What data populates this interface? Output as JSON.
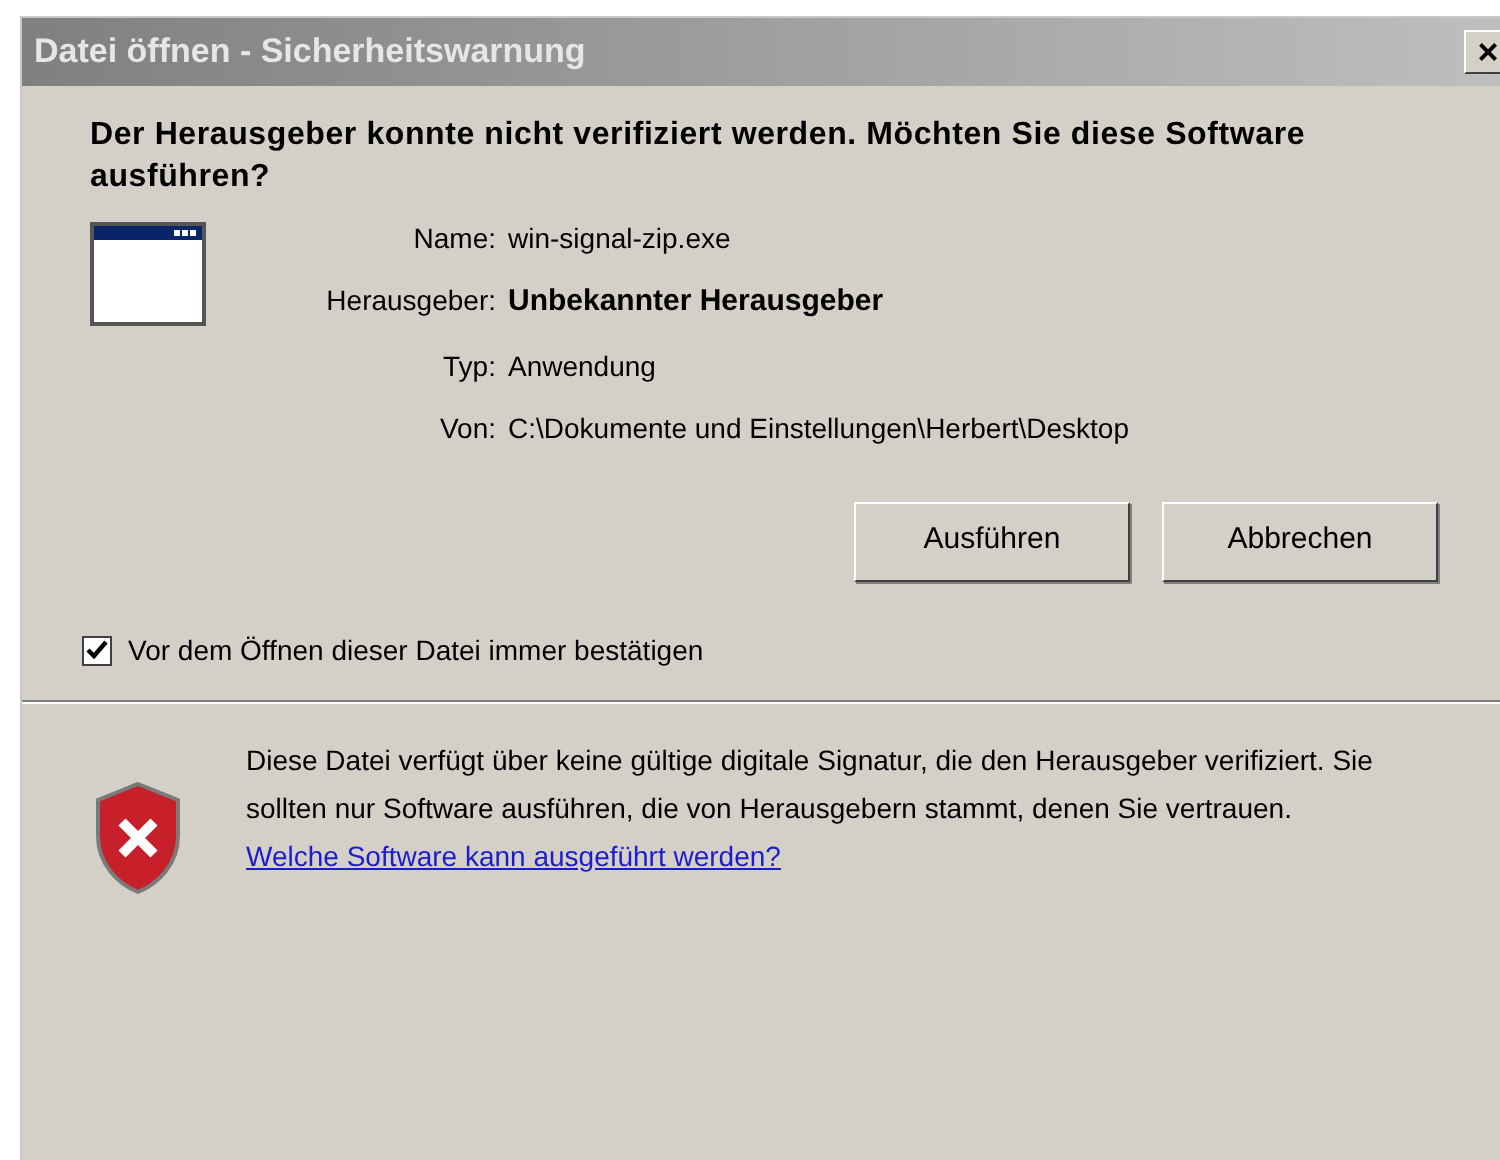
{
  "window": {
    "title": "Datei öffnen - Sicherheitswarnung",
    "close": "×"
  },
  "heading": "Der Herausgeber konnte nicht verifiziert werden. Möchten Sie diese Software ausführen?",
  "details": [
    {
      "label": "Name:",
      "value": "win-signal-zip.exe",
      "bold": false
    },
    {
      "label": "Herausgeber:",
      "value": "Unbekannter Herausgeber",
      "bold": true
    },
    {
      "label": "Typ:",
      "value": "Anwendung",
      "bold": false
    },
    {
      "label": "Von:",
      "value": "C:\\Dokumente und Einstellungen\\Herbert\\Desktop",
      "bold": false
    }
  ],
  "buttons": [
    "Ausführen",
    "Abbrechen"
  ],
  "confirm": {
    "label": "Vor dem Öffnen dieser Datei immer bestätigen",
    "checked": true
  },
  "warning": {
    "text": "Diese Datei verfügt über keine gültige digitale Signatur, die den Herausgeber verifiziert. Sie sollten nur Software ausführen, die von Herausgebern stammt, denen Sie vertrauen.",
    "link": "Welche Software kann ausgeführt werden?"
  }
}
